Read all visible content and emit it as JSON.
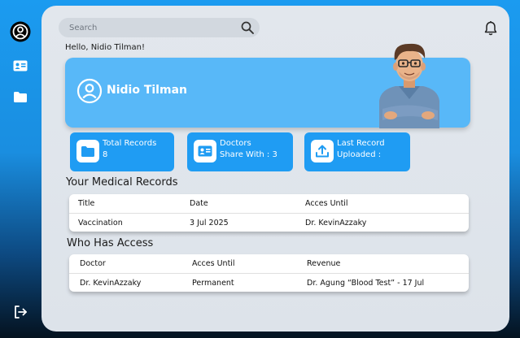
{
  "sidebar": {
    "items": [
      {
        "icon": "user-circle-icon"
      },
      {
        "icon": "id-card-icon"
      },
      {
        "icon": "folder-icon"
      }
    ],
    "logout_icon": "logout-icon"
  },
  "header": {
    "search_placeholder": "Search",
    "greeting": "Hello, Nidio Tilman!"
  },
  "profile": {
    "name": "Nidio Tilman"
  },
  "stats": [
    {
      "line1": "Total Records",
      "line2": "8",
      "icon": "folder-icon"
    },
    {
      "line1": "Doctors",
      "line2": "Share With : 3",
      "icon": "id-card-icon"
    },
    {
      "line1": "Last Record",
      "line2": "Uploaded :",
      "icon": "upload-icon"
    }
  ],
  "records": {
    "title": "Your Medical Records",
    "headers": [
      "Title",
      "Date",
      "Acces Until"
    ],
    "rows": [
      [
        "Vaccination",
        "3 Jul 2025",
        "Dr. KevinAzzaky"
      ]
    ]
  },
  "access": {
    "title": "Who Has Access",
    "headers": [
      "Doctor",
      "Acces Until",
      "Revenue"
    ],
    "rows": [
      [
        "Dr. KevinAzzaky",
        "Permanent",
        "Dr. Agung “Blood Test” - 17 Jul"
      ]
    ]
  },
  "colors": {
    "accent": "#1f9cf3",
    "hero": "#58b8f8",
    "panel": "#e2e7ed"
  }
}
